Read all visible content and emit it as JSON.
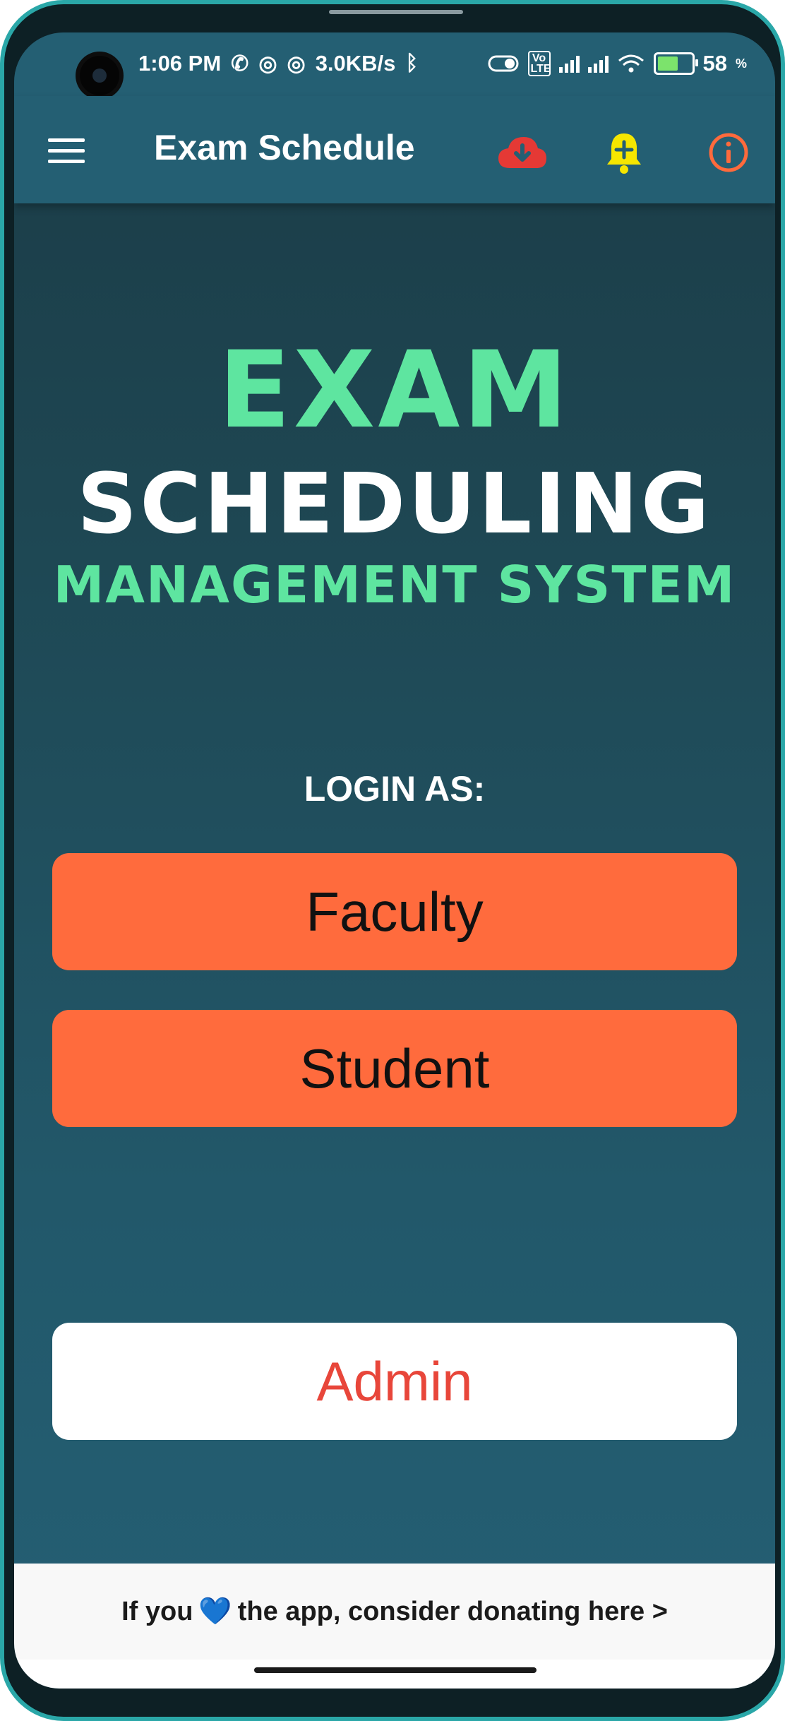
{
  "status_bar": {
    "time": "1:06 PM",
    "net_speed": "3.0KB/s",
    "battery_level": "58",
    "battery_unit": "%",
    "volte": "Vo LTE"
  },
  "app_bar": {
    "title": "Exam Schedule",
    "menu_icon": "hamburger-menu-icon",
    "download_icon": "cloud-download-icon",
    "notify_icon": "bell-plus-icon",
    "info_icon": "info-icon",
    "colors": {
      "bar": "#245f73",
      "download": "#e53935",
      "bell": "#f5e600",
      "info": "#ff6a3c"
    }
  },
  "hero": {
    "line1": "EXAM",
    "line2": "SCHEDULING",
    "line3": "MANAGEMENT SYSTEM",
    "accent_color": "#5ee5a0"
  },
  "login": {
    "heading": "LOGIN AS:",
    "faculty_label": "Faculty",
    "student_label": "Student",
    "admin_label": "Admin",
    "button_color": "#ff6b3d"
  },
  "footer": {
    "donate_prefix": "If you",
    "donate_heart": "💙",
    "donate_suffix": "the app, consider donating here >"
  }
}
